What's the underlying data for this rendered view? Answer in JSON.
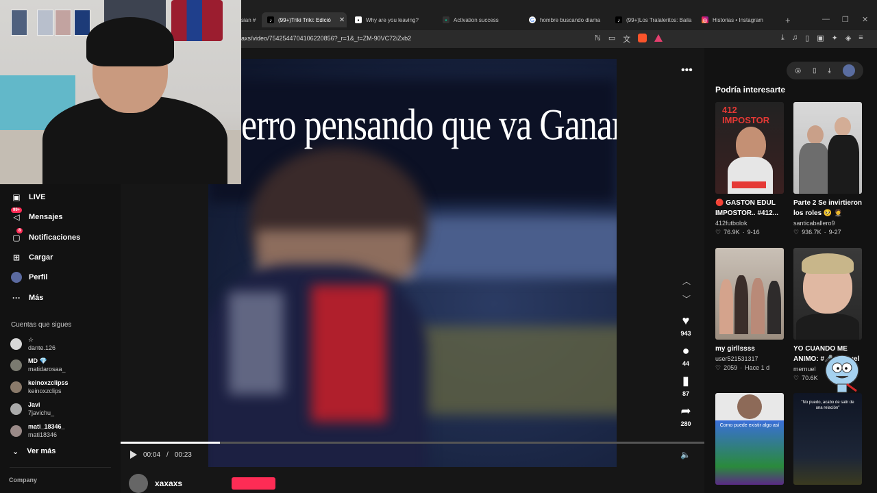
{
  "browser": {
    "tabs": [
      {
        "label": "sian #",
        "icon": "",
        "active": false
      },
      {
        "label": "(99+)Triki Triki: Edició",
        "icon": "tiktok-icon",
        "active": true
      },
      {
        "label": "Why are you leaving?",
        "icon": "app-icon",
        "active": false
      },
      {
        "label": "Activation success",
        "icon": "app-icon",
        "active": false
      },
      {
        "label": "hombre buscando diama",
        "icon": "google-icon",
        "active": false
      },
      {
        "label": "(99+)Los Tralaleritos: Baila",
        "icon": "tiktok-icon",
        "active": false
      },
      {
        "label": "Historias • Instagram",
        "icon": "instagram-icon",
        "active": false
      }
    ],
    "url": "axs/video/7542544704106220856?_r=1&_t=ZM-90VC72iZxb2"
  },
  "sidebar": {
    "nav": [
      {
        "label": "LIVE",
        "icon": "live-icon",
        "badge": ""
      },
      {
        "label": "Mensajes",
        "icon": "messages-icon",
        "badge": "99+"
      },
      {
        "label": "Notificaciones",
        "icon": "notifications-icon",
        "badge": "8"
      },
      {
        "label": "Cargar",
        "icon": "upload-icon",
        "badge": ""
      },
      {
        "label": "Perfil",
        "icon": "profile-avatar",
        "badge": ""
      },
      {
        "label": "Más",
        "icon": "more-icon",
        "badge": ""
      }
    ],
    "following_title": "Cuentas que sigues",
    "following": [
      {
        "name": "☆",
        "handle": "dante.126"
      },
      {
        "name": "MD 💎",
        "handle": "matidarosaa_"
      },
      {
        "name": "keinoxzclipss",
        "handle": "keinoxzclips"
      },
      {
        "name": "Javi",
        "handle": "7javichu_"
      },
      {
        "name": "mati_18346_",
        "handle": "mati18346"
      }
    ],
    "see_more": "Ver más",
    "company": "Company"
  },
  "video": {
    "caption_text": "erro pensando que va Ganar",
    "time_current": "00:04",
    "time_total": "00:23",
    "progress": 0.17,
    "author": "xaxaxs",
    "actions": [
      {
        "icon": "heart-icon",
        "count": "943"
      },
      {
        "icon": "comment-icon",
        "count": "44"
      },
      {
        "icon": "bookmark-icon",
        "count": "87"
      },
      {
        "icon": "share-icon",
        "count": "280"
      }
    ]
  },
  "recommendations": {
    "title": "Podría interesarte",
    "items": [
      {
        "title": "🔴 GASTON EDUL IMPOSTOR.. #412...",
        "user": "412futbolok",
        "likes": "76.9K",
        "date": "9-16",
        "thumb_text": "412 IMPOSTOR"
      },
      {
        "title": "Parte 2 Se invirtieron los roles 🥺 🤵",
        "user": "santicaballero9",
        "likes": "936.7K",
        "date": "9-27",
        "thumb_text": ""
      },
      {
        "title": "my girllssss",
        "user": "user521531317",
        "likes": "2059",
        "date": "Hace 1 d",
        "thumb_text": ""
      },
      {
        "title": "YO CUANDO ME ANIMO: #🎤mernuel",
        "user": "mernuel",
        "likes": "70.6K",
        "date": "",
        "thumb_text": ""
      },
      {
        "title": "",
        "user": "",
        "likes": "",
        "date": "",
        "thumb_text": "Como puede existir algo así"
      },
      {
        "title": "",
        "user": "",
        "likes": "",
        "date": "",
        "thumb_text": "\"No puedo, acabo de salir de una relación\""
      }
    ]
  },
  "colors": {
    "accent": "#fe2c55",
    "background": "#121212"
  }
}
